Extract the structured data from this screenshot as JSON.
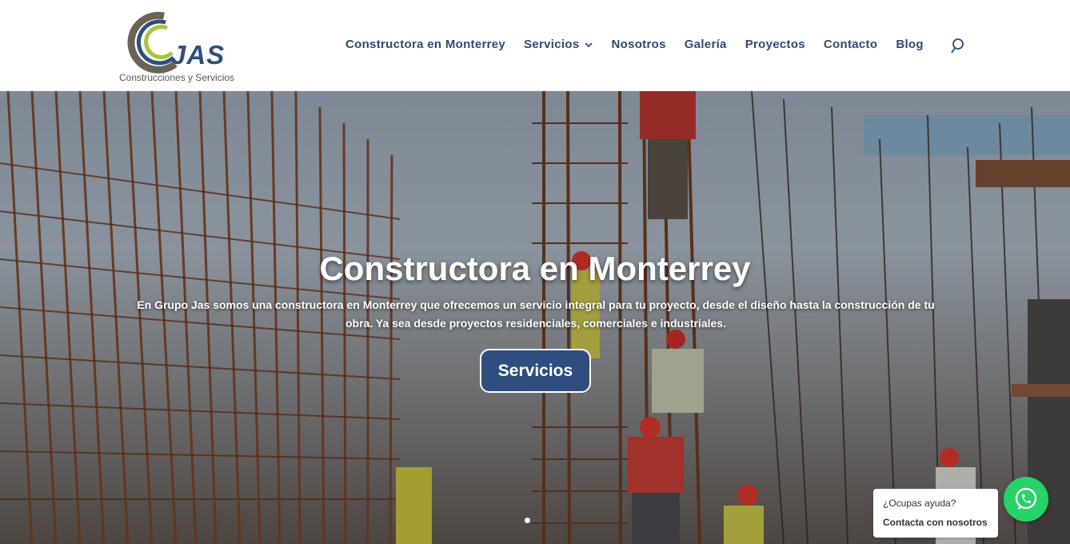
{
  "header": {
    "logo_text": "JAS",
    "logo_subtitle": "Construcciones y Servicios",
    "nav": [
      {
        "label": "Constructora en Monterrey"
      },
      {
        "label": "Servicios",
        "has_dropdown": true
      },
      {
        "label": "Nosotros"
      },
      {
        "label": "Galería"
      },
      {
        "label": "Proyectos"
      },
      {
        "label": "Contacto"
      },
      {
        "label": "Blog"
      }
    ],
    "search_icon": "search-icon"
  },
  "hero": {
    "title": "Constructora en Monterrey",
    "description": "En Grupo Jas somos una constructora en Monterrey que ofrecemos un servicio integral para tu proyecto, desde el diseño hasta la construcción de tu obra. Ya sea desde proyectos residenciales, comerciales e industriales.",
    "button_label": "Servicios",
    "slides_count": 1,
    "active_slide": 1
  },
  "chat": {
    "text": "¿Ocupas ayuda?",
    "link_text": "Contacta con nosotros",
    "icon": "whatsapp-icon"
  },
  "colors": {
    "brand_blue": "#2e4b74",
    "button_blue": "#2f4d7e",
    "whatsapp_green": "#25d366"
  }
}
